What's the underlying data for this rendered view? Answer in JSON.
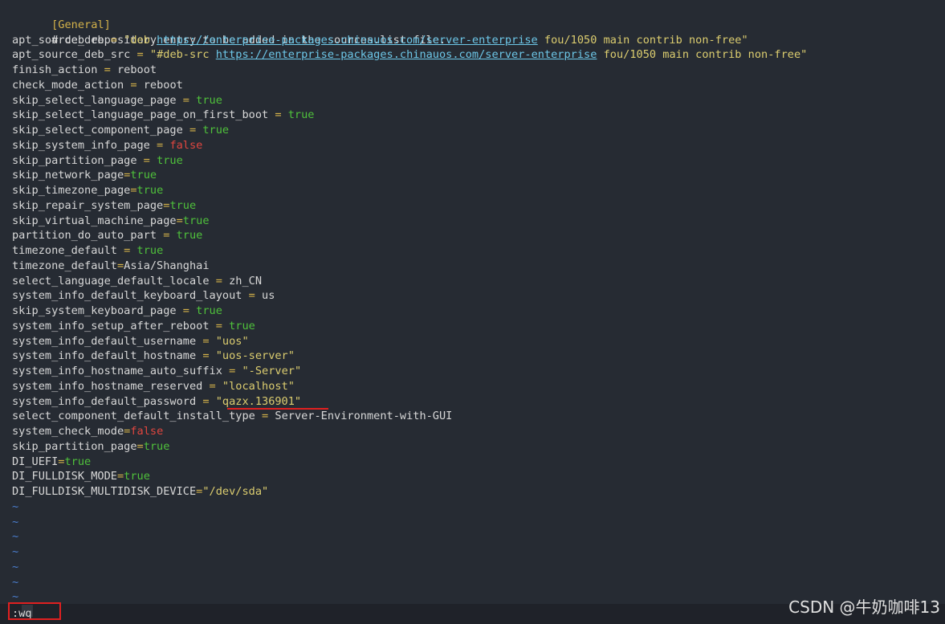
{
  "editor": {
    "section": "[General]",
    "comment": "# deb repository entry to be added in the sources.list file.",
    "apt_source_deb": {
      "key": "apt_source_deb",
      "op": " = ",
      "str_open": "\"deb ",
      "url": "https://enterprise-packages.chinauos.com/server-enterprise",
      "str_rest": " fou/1050 main contrib non-free\""
    },
    "apt_source_deb_src": {
      "key": "apt_source_deb_src",
      "op": " = ",
      "str_open": "\"#deb-src ",
      "url": "https://enterprise-packages.chinauos.com/server-enterprise",
      "str_rest": " fou/1050 main contrib non-free\""
    },
    "lines": [
      {
        "key": "finish_action",
        "op": " = ",
        "value": "reboot",
        "type": "plain"
      },
      {
        "key": "check_mode_action",
        "op": " = ",
        "value": "reboot",
        "type": "plain"
      },
      {
        "key": "skip_select_language_page",
        "op": " = ",
        "value": "true",
        "type": "true"
      },
      {
        "key": "skip_select_language_page_on_first_boot",
        "op": " = ",
        "value": "true",
        "type": "true"
      },
      {
        "key": "skip_select_component_page",
        "op": " = ",
        "value": "true",
        "type": "true"
      },
      {
        "key": "skip_system_info_page",
        "op": " = ",
        "value": "false",
        "type": "false"
      },
      {
        "key": "skip_partition_page",
        "op": " = ",
        "value": "true",
        "type": "true"
      },
      {
        "key": "skip_network_page",
        "op": "=",
        "value": "true",
        "type": "true"
      },
      {
        "key": "skip_timezone_page",
        "op": "=",
        "value": "true",
        "type": "true"
      },
      {
        "key": "skip_repair_system_page",
        "op": "=",
        "value": "true",
        "type": "true"
      },
      {
        "key": "skip_virtual_machine_page",
        "op": "=",
        "value": "true",
        "type": "true"
      },
      {
        "key": "partition_do_auto_part",
        "op": " = ",
        "value": "true",
        "type": "true"
      },
      {
        "key": "timezone_default",
        "op": " = ",
        "value": "true",
        "type": "true"
      },
      {
        "key": "timezone_default",
        "op": "=",
        "value": "Asia/Shanghai",
        "type": "plain"
      },
      {
        "key": "select_language_default_locale",
        "op": " = ",
        "value": "zh_CN",
        "type": "plain"
      },
      {
        "key": "system_info_default_keyboard_layout",
        "op": " = ",
        "value": "us",
        "type": "plain"
      },
      {
        "key": "skip_system_keyboard_page",
        "op": " = ",
        "value": "true",
        "type": "true"
      },
      {
        "key": "system_info_setup_after_reboot",
        "op": " = ",
        "value": "true",
        "type": "true"
      },
      {
        "key": "system_info_default_username",
        "op": " = ",
        "value": "\"uos\"",
        "type": "str"
      },
      {
        "key": "system_info_default_hostname",
        "op": " = ",
        "value": "\"uos-server\"",
        "type": "str"
      },
      {
        "key": "system_info_hostname_auto_suffix",
        "op": " = ",
        "value": "\"-Server\"",
        "type": "str"
      },
      {
        "key": "system_info_hostname_reserved",
        "op": " = ",
        "value": "\"localhost\"",
        "type": "str"
      },
      {
        "key": "system_info_default_password",
        "op": " = ",
        "value": "\"qazx.136901\"",
        "type": "str"
      },
      {
        "key": "select_component_default_install_type",
        "op": " = ",
        "value": "Server-Environment-with-GUI",
        "type": "plain"
      },
      {
        "key": "system_check_mode",
        "op": "=",
        "value": "false",
        "type": "false"
      },
      {
        "key": "skip_partition_page",
        "op": "=",
        "value": "true",
        "type": "true"
      },
      {
        "key": "DI_UEFI",
        "op": "=",
        "value": "true",
        "type": "true"
      },
      {
        "key": "DI_FULLDISK_MODE",
        "op": "=",
        "value": "true",
        "type": "true"
      },
      {
        "key": "DI_FULLDISK_MULTIDISK_DEVICE",
        "op": "=",
        "value": "\"/dev/sda\"",
        "type": "str"
      }
    ],
    "tilde": "~",
    "tilde_count": 7
  },
  "command_line": {
    "text": ":wq"
  },
  "watermark": "CSDN @牛奶咖啡13",
  "colors": {
    "background": "#262b33",
    "true_value": "#4fc13b",
    "false_value": "#e0463f",
    "string_value": "#dccd6f",
    "url": "#6dc7e8",
    "annotation_red": "#e02020"
  }
}
